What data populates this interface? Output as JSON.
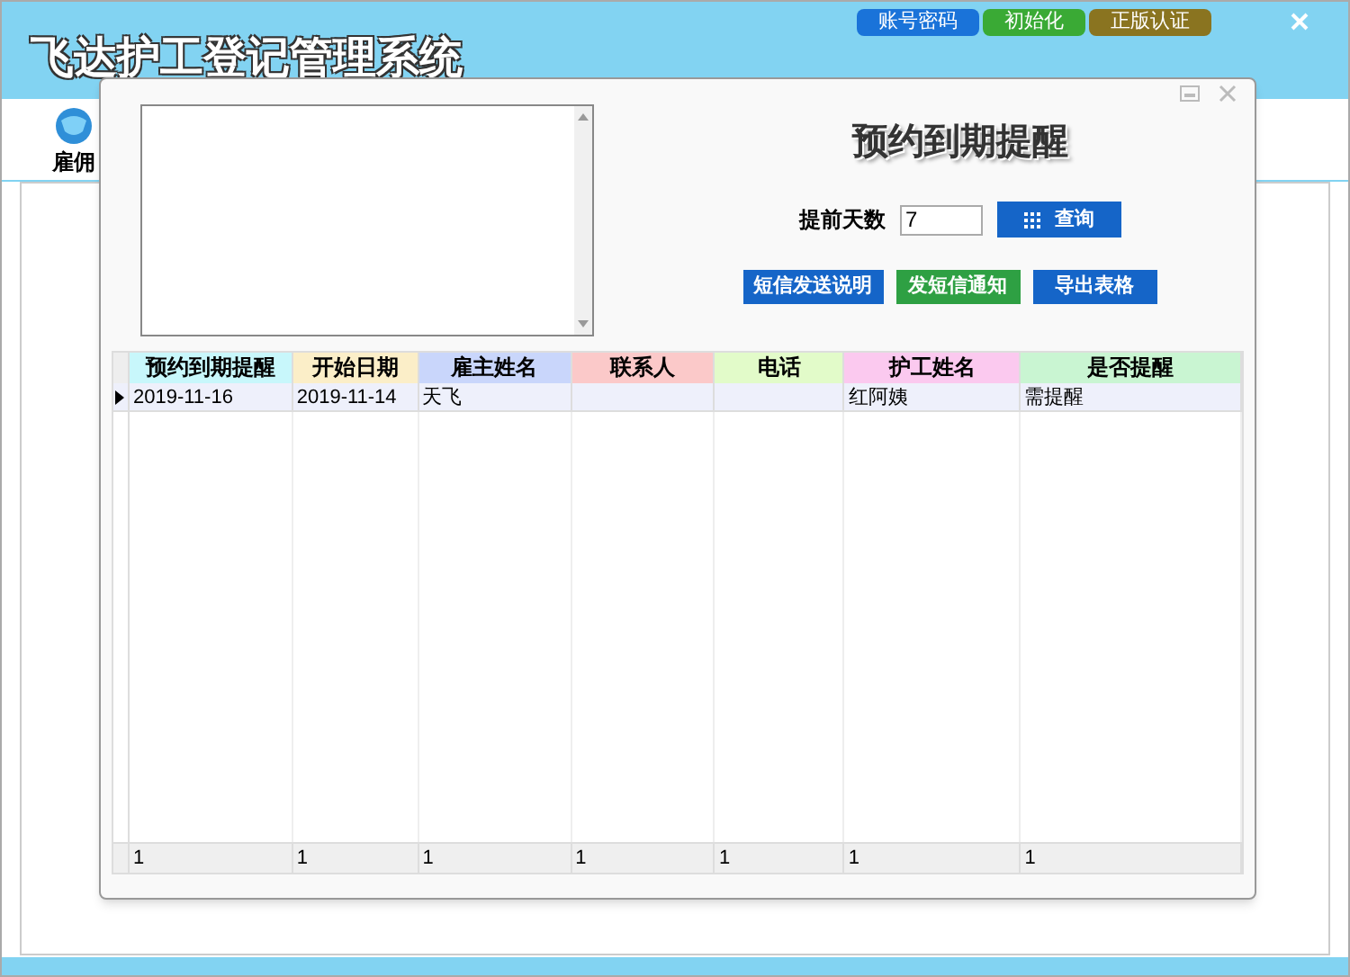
{
  "window": {
    "title": "飞达护工登记管理系统"
  },
  "top_buttons": [
    {
      "label": "账号密码",
      "color": "#1a73d9"
    },
    {
      "label": "初始化",
      "color": "#3aaa35"
    },
    {
      "label": "正版认证",
      "color": "#8a7420"
    }
  ],
  "toolbar": {
    "items": [
      {
        "label": "雇佣"
      }
    ]
  },
  "dialog": {
    "title": "预约到期提醒",
    "days_label": "提前天数",
    "days_value": "7",
    "query_button": "查询",
    "actions": [
      {
        "label": "短信发送说明",
        "color": "#1565c8"
      },
      {
        "label": "发短信通知",
        "color": "#2ea043"
      },
      {
        "label": "导出表格",
        "color": "#1565c8"
      }
    ],
    "table": {
      "columns": [
        {
          "label": "预约到期提醒",
          "color": "#c8f7fb"
        },
        {
          "label": "开始日期",
          "color": "#fbeec8"
        },
        {
          "label": "雇主姓名",
          "color": "#c9d6fb"
        },
        {
          "label": "联系人",
          "color": "#fbc9c9"
        },
        {
          "label": "电话",
          "color": "#e2fbc9"
        },
        {
          "label": "护工姓名",
          "color": "#fbc9ef"
        },
        {
          "label": "是否提醒",
          "color": "#c9f5d2"
        }
      ],
      "rows": [
        {
          "selected": true,
          "cells": [
            "2019-11-16",
            "2019-11-14",
            "天飞",
            "",
            "",
            "红阿姨",
            "需提醒"
          ]
        }
      ],
      "footer": [
        "1",
        "1",
        "1",
        "1",
        "1",
        "1",
        "1"
      ]
    }
  }
}
